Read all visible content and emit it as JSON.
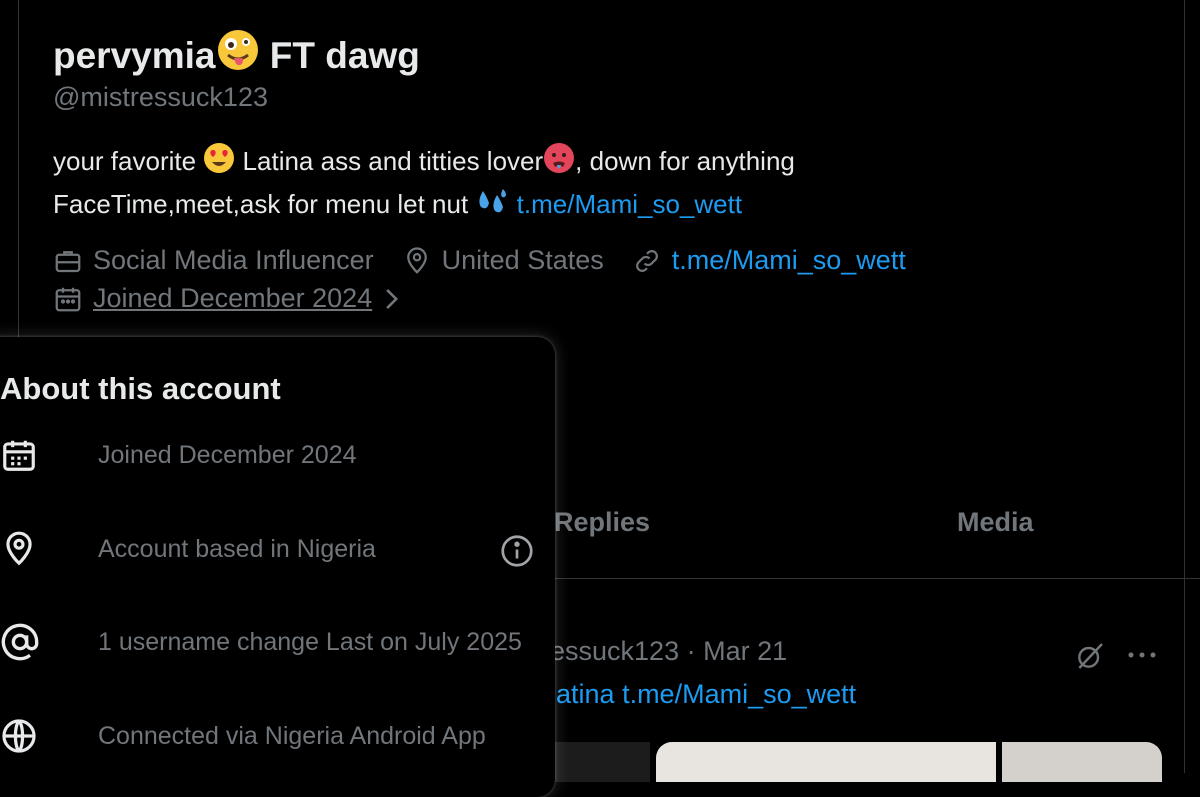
{
  "colors": {
    "background": "#000000",
    "text_primary": "#e7e9ea",
    "text_secondary": "#71767b",
    "link": "#1d9bf0",
    "border": "#2f3336"
  },
  "profile": {
    "display_name_part1": "pervymia",
    "display_name_emoji": "zany-face-emoji",
    "display_name_part2": "FT dawg",
    "handle": "@mistressuck123",
    "bio": {
      "line1_a": "your favorite",
      "line1_emoji_1": "heart-eyes-emoji",
      "line1_b": "Latina ass and titties lover",
      "line1_emoji_2": "hot-face-emoji",
      "line1_c": ", down for anything",
      "line2_a": "FaceTime,meet,ask for menu let nut",
      "line2_emoji": "sweat-droplets-emoji",
      "line2_link": "t.me/Mami_so_wett"
    },
    "meta": {
      "category": "Social Media Influencer",
      "location": "United States",
      "website": "t.me/Mami_so_wett",
      "joined": "Joined December 2024"
    }
  },
  "tabs": {
    "replies": "Replies",
    "media": "Media"
  },
  "post": {
    "handle_fragment": "essuck123",
    "separator": "·",
    "date": "Mar 21",
    "text_prefix": "latina",
    "text_link": "t.me/Mami_so_wett",
    "icons": [
      "grok-icon",
      "more-icon"
    ]
  },
  "about_popover": {
    "title": "About this account",
    "rows": [
      {
        "icon": "calendar-icon",
        "text": "Joined December 2024"
      },
      {
        "icon": "location-pin-icon",
        "text": "Account based in Nigeria",
        "trailing_icon": "info-icon"
      },
      {
        "icon": "at-sign-icon",
        "text": "1 username change Last on July 2025"
      },
      {
        "icon": "globe-icon",
        "text": "Connected via Nigeria Android App"
      }
    ]
  }
}
